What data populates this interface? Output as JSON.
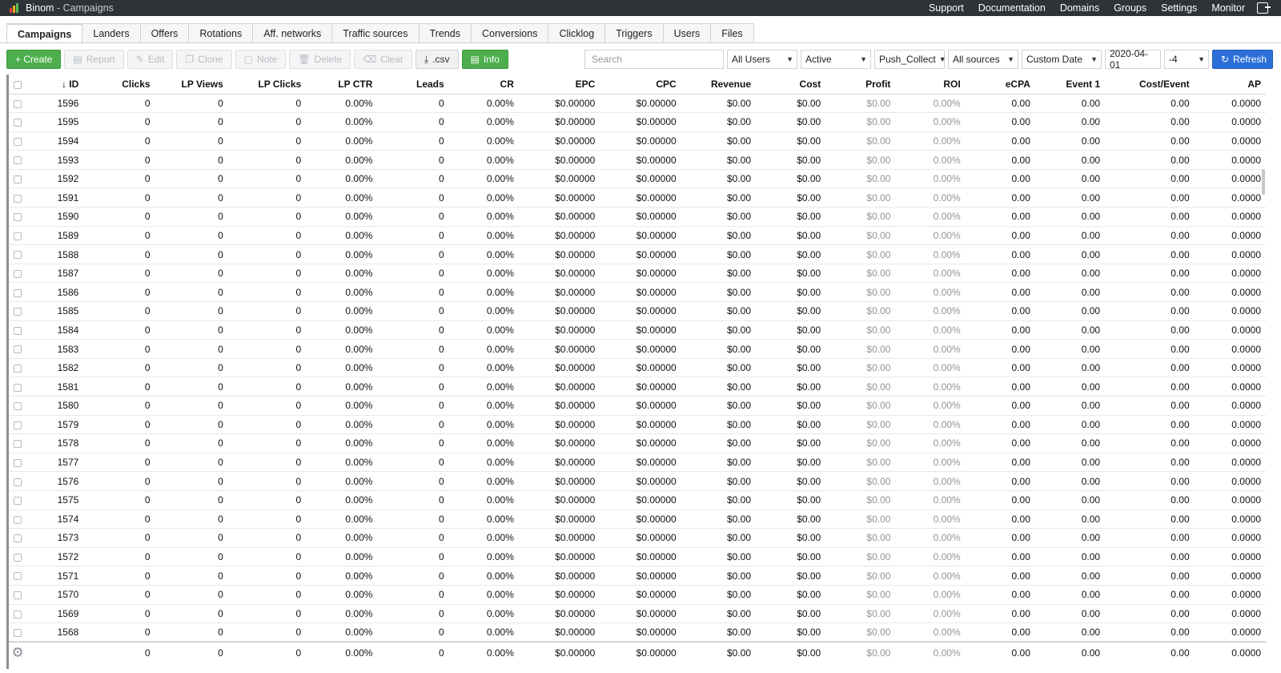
{
  "app": {
    "name": "Binom",
    "separator": "-",
    "page": "Campaigns"
  },
  "top_menu": [
    "Support",
    "Documentation",
    "Domains",
    "Groups",
    "Settings",
    "Monitor"
  ],
  "tabs": [
    {
      "label": "Campaigns",
      "active": true
    },
    {
      "label": "Landers"
    },
    {
      "label": "Offers"
    },
    {
      "label": "Rotations"
    },
    {
      "label": "Aff. networks"
    },
    {
      "label": "Traffic sources"
    },
    {
      "label": "Trends"
    },
    {
      "label": "Conversions"
    },
    {
      "label": "Clicklog"
    },
    {
      "label": "Triggers"
    },
    {
      "label": "Users"
    },
    {
      "label": "Files"
    }
  ],
  "toolbar": {
    "create": "+ Create",
    "report": "Report",
    "edit": "Edit",
    "clone": "Clone",
    "note": "Note",
    "delete": "Delete",
    "clear": "Clear",
    "csv": ".csv",
    "info": "Info"
  },
  "filters": {
    "search_placeholder": "Search",
    "users": "All Users",
    "status": "Active",
    "group": "Push_Collect",
    "sources": "All sources",
    "date_mode": "Custom Date",
    "date": "2020-04-01",
    "timezone": "-4",
    "refresh": "Refresh"
  },
  "colors": {
    "green": "#4cae4c",
    "blue": "#2c6fd8",
    "topbar": "#2e3338"
  },
  "table": {
    "columns": [
      "ID",
      "Clicks",
      "LP Views",
      "LP Clicks",
      "LP CTR",
      "Leads",
      "CR",
      "EPC",
      "CPC",
      "Revenue",
      "Cost",
      "Profit",
      "ROI",
      "eCPA",
      "Event 1",
      "Cost/Event",
      "AP"
    ],
    "sort_column": "ID",
    "sort_direction": "desc",
    "row_template": [
      "0",
      "0",
      "0",
      "0.00%",
      "0",
      "0.00%",
      "$0.00000",
      "$0.00000",
      "$0.00",
      "$0.00",
      "$0.00",
      "0.00%",
      "0.00",
      "0.00",
      "0.00",
      "0.0000"
    ],
    "ids": [
      "1596",
      "1595",
      "1594",
      "1593",
      "1592",
      "1591",
      "1590",
      "1589",
      "1588",
      "1587",
      "1586",
      "1585",
      "1584",
      "1583",
      "1582",
      "1581",
      "1580",
      "1579",
      "1578",
      "1577",
      "1576",
      "1575",
      "1574",
      "1573",
      "1572",
      "1571",
      "1570",
      "1569",
      "1568"
    ],
    "totals": [
      "0",
      "0",
      "0",
      "0.00%",
      "0",
      "0.00%",
      "$0.00000",
      "$0.00000",
      "$0.00",
      "$0.00",
      "$0.00",
      "0.00%",
      "0.00",
      "0.00",
      "0.00",
      "0.0000"
    ]
  }
}
